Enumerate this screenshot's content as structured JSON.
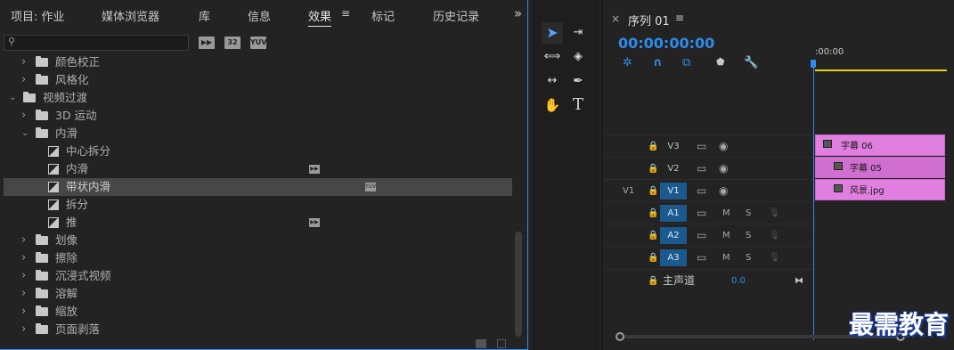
{
  "left_panel": {
    "tabs": [
      {
        "label": "项目: 作业"
      },
      {
        "label": "媒体浏览器"
      },
      {
        "label": "库"
      },
      {
        "label": "信息"
      },
      {
        "label": "效果"
      },
      {
        "label": "标记"
      },
      {
        "label": "历史记录"
      }
    ],
    "active_tab": "效果",
    "menu_glyph": "≡",
    "overflow_glyph": "»",
    "search": {
      "value": "",
      "placeholder": ""
    },
    "filter_badges": [
      "32",
      "YUV"
    ],
    "tree": [
      {
        "label": "颜色校正",
        "type": "folder",
        "expanded": false,
        "indent": 1
      },
      {
        "label": "风格化",
        "type": "folder",
        "expanded": false,
        "indent": 1
      },
      {
        "label": "视频过渡",
        "type": "folder",
        "expanded": true,
        "indent": 0
      },
      {
        "label": "3D 运动",
        "type": "folder",
        "expanded": false,
        "indent": 1
      },
      {
        "label": "内滑",
        "type": "folder",
        "expanded": true,
        "indent": 1
      },
      {
        "label": "中心拆分",
        "type": "effect",
        "indent": 2
      },
      {
        "label": "内滑",
        "type": "effect",
        "indent": 2,
        "badge": "accelerated"
      },
      {
        "label": "带状内滑",
        "type": "effect",
        "indent": 2,
        "badge": "YUV",
        "selected": true
      },
      {
        "label": "拆分",
        "type": "effect",
        "indent": 2
      },
      {
        "label": "推",
        "type": "effect",
        "indent": 2,
        "badge": "accelerated"
      },
      {
        "label": "划像",
        "type": "folder",
        "expanded": false,
        "indent": 1
      },
      {
        "label": "擦除",
        "type": "folder",
        "expanded": false,
        "indent": 1
      },
      {
        "label": "沉浸式视频",
        "type": "folder",
        "expanded": false,
        "indent": 1
      },
      {
        "label": "溶解",
        "type": "folder",
        "expanded": false,
        "indent": 1
      },
      {
        "label": "缩放",
        "type": "folder",
        "expanded": false,
        "indent": 1
      },
      {
        "label": "页面剥落",
        "type": "folder",
        "expanded": false,
        "indent": 1
      }
    ]
  },
  "tools": [
    "selection-tool",
    "track-select-tool",
    "ripple-edit-tool",
    "razor-tool",
    "slip-tool",
    "pen-tool",
    "hand-tool",
    "type-tool"
  ],
  "timeline": {
    "close_glyph": "×",
    "title": "序列 01",
    "menu_glyph": "≡",
    "timecode": "00:00:00:00",
    "ruler_start": ":00:00",
    "video_tracks": [
      {
        "name": "V3",
        "source": "",
        "clip": "字幕 06"
      },
      {
        "name": "V2",
        "source": "",
        "clip": "字幕 05"
      },
      {
        "name": "V1",
        "source": "V1",
        "clip": "风景.jpg"
      }
    ],
    "audio_tracks": [
      {
        "name": "A1",
        "m": "M",
        "s": "S"
      },
      {
        "name": "A2",
        "m": "M",
        "s": "S"
      },
      {
        "name": "A3",
        "m": "M",
        "s": "S"
      }
    ],
    "master": {
      "label": "主声道",
      "value": "0.0"
    }
  },
  "watermark": "最需教育",
  "colors": {
    "accent": "#2d8ceb",
    "clip": "#e07fe0",
    "ruler": "#e8d400"
  }
}
